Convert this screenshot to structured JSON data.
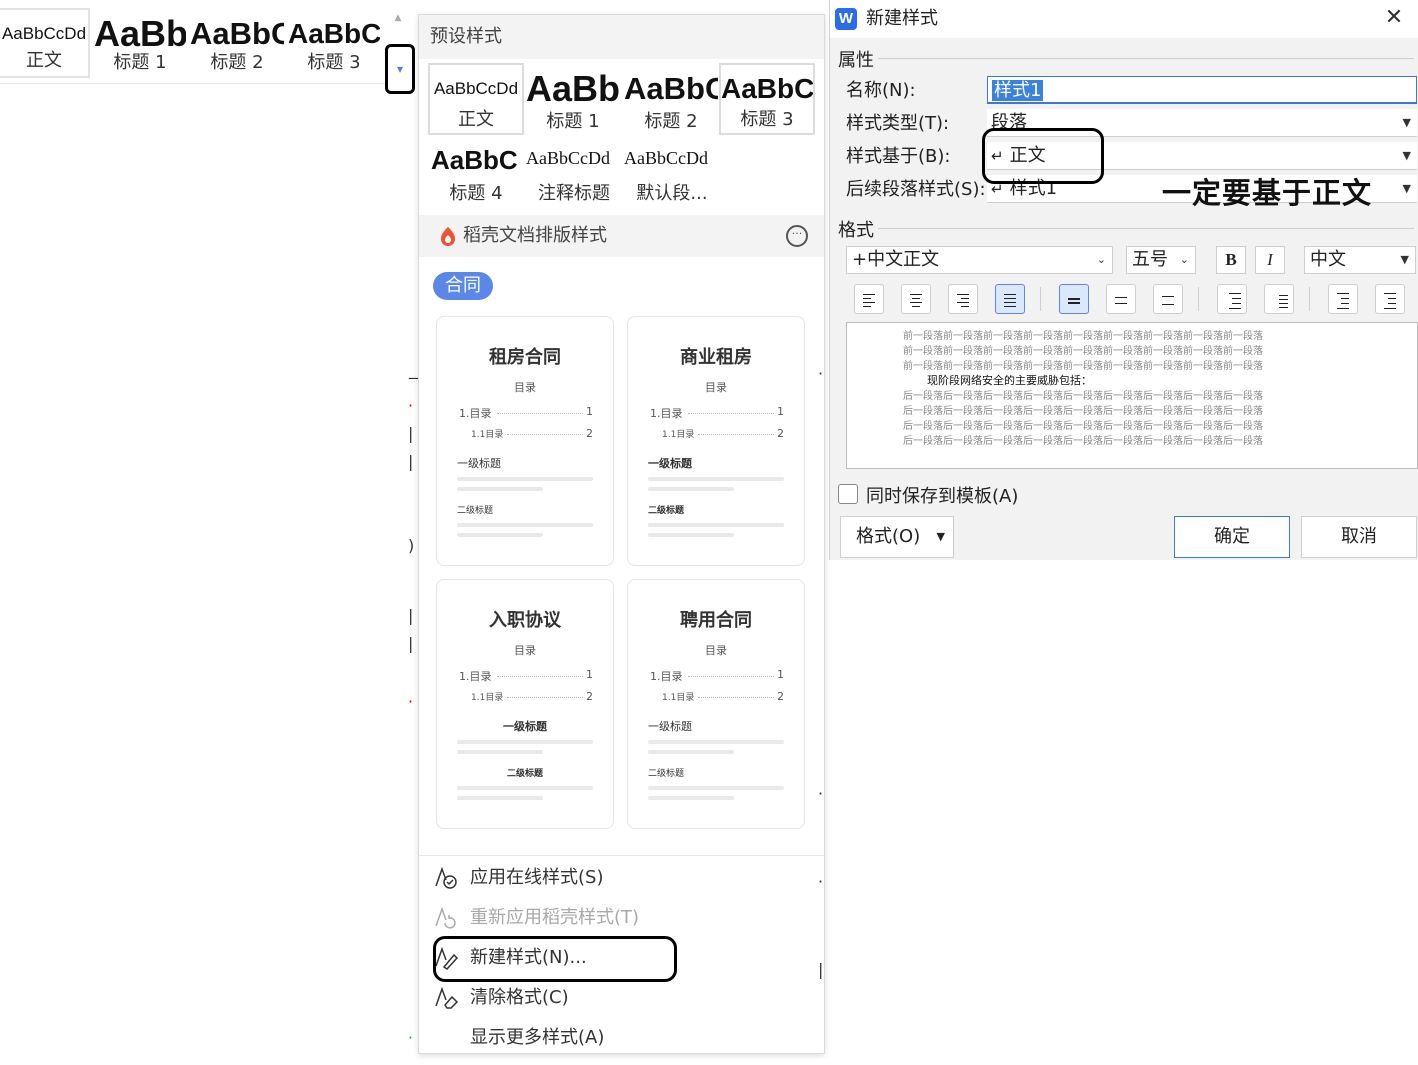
{
  "ribbon": {
    "gallery": [
      {
        "sample": "AaBbCcDd",
        "label": "正文"
      },
      {
        "sample": "AaBb",
        "label": "标题 1"
      },
      {
        "sample": "AaBbC",
        "label": "标题 2"
      },
      {
        "sample": "AaBbCc",
        "label": "标题 3"
      }
    ],
    "up_icon": "chevron-up-icon",
    "more_icon": "expand-more-icon",
    "more_glyph": "▾"
  },
  "panel": {
    "header": "预设样式",
    "styles": [
      {
        "sample": "AaBbCcDd",
        "label": "正文"
      },
      {
        "sample": "AaBb",
        "label": "标题 1"
      },
      {
        "sample": "AaBbC",
        "label": "标题 2"
      },
      {
        "sample": "AaBbC",
        "label": "标题 3"
      },
      {
        "sample": "AaBbC",
        "label": "标题 4"
      },
      {
        "sample": "AaBbCcDd",
        "label": "注释标题"
      },
      {
        "sample": "AaBbCcDd",
        "label": "默认段..."
      }
    ],
    "daoke": {
      "label": "稻壳文档排版样式",
      "comment_glyph": "···"
    },
    "tag": "合同",
    "toc": {
      "heading": "目录",
      "row1": "1.目录",
      "row1_num": "1",
      "row2": "1.1目录",
      "row2_num": "2",
      "h1": "一级标题",
      "h2": "二级标题"
    },
    "templates": [
      {
        "title": "租房合同"
      },
      {
        "title": "商业租房"
      },
      {
        "title": "入职协议"
      },
      {
        "title": "聘用合同"
      }
    ],
    "menu": [
      {
        "label": "应用在线样式(S)",
        "icon": "online-style-icon",
        "enabled": true
      },
      {
        "label": "重新应用稻壳样式(T)",
        "icon": "reapply-style-icon",
        "enabled": false
      },
      {
        "label": "新建样式(N)...",
        "icon": "new-style-icon",
        "enabled": true
      },
      {
        "label": "清除格式(C)",
        "icon": "clear-format-icon",
        "enabled": true
      },
      {
        "label": "显示更多样式(A)",
        "icon": "",
        "enabled": true
      }
    ]
  },
  "dialog": {
    "title": "新建样式",
    "app_icon_letter": "W",
    "close_glyph": "✕",
    "section_properties": "属性",
    "name_label": "名称(N):",
    "name_value": "样式1",
    "type_label": "样式类型(T):",
    "type_value": "段落",
    "based_label": "样式基于(B):",
    "based_value": "正文",
    "next_label": "后续段落样式(S):",
    "next_value": "样式1",
    "return_glyph": "↵",
    "annotation": "一定要基于正文",
    "section_format": "格式",
    "font_value": "+中文正文",
    "size_value": "五号",
    "bold": "B",
    "italic": "I",
    "lang_value": "中文",
    "preview": {
      "prev_line": "前一段落前一段落前一段落前一段落前一段落前一段落前一段落前一段落前一段落",
      "current_text": "现阶段网络安全的主要威胁包括：",
      "next_line": "后一段落后一段落后一段落后一段落后一段落后一段落后一段落后一段落后一段落"
    },
    "save_to_template": "同时保存到模板(A)",
    "format_button": "格式(O)",
    "ok": "确定",
    "cancel": "取消",
    "arrow_glyph": "▼",
    "chevron_glyph": "⌄"
  }
}
